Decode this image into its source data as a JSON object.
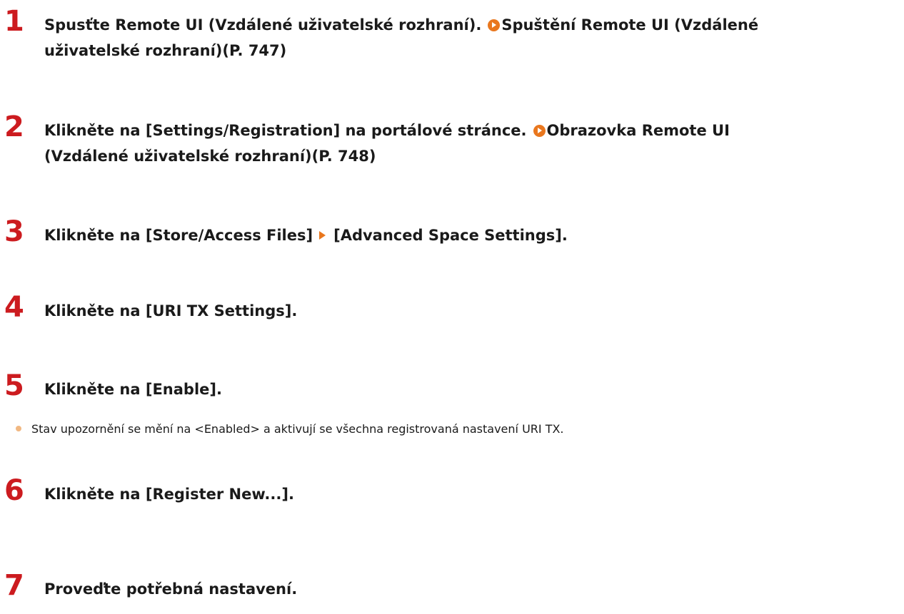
{
  "steps": [
    {
      "number": "1",
      "text": "Spusťte Remote UI (Vzdálené uživatelské rozhraní).",
      "link": "Spuštění Remote UI (Vzdálené",
      "link_cont": "uživatelské rozhraní)(P. 747)"
    },
    {
      "number": "2",
      "text": "Klikněte na [Settings/Registration] na portálové stránce.",
      "link": "Obrazovka Remote UI",
      "link_cont": "(Vzdálené uživatelské rozhraní)(P. 748)"
    },
    {
      "number": "3",
      "text_before": "Klikněte na [Store/Access Files]",
      "text_after": "[Advanced Space Settings]."
    },
    {
      "number": "4",
      "text": "Klikněte na [URI TX Settings]."
    },
    {
      "number": "5",
      "text": "Klikněte na [Enable].",
      "bullet": "Stav upozornění se mění na <Enabled> a aktivují se všechna registrovaná nastavení URI TX."
    },
    {
      "number": "6",
      "text": "Klikněte na [Register New...]."
    },
    {
      "number": "7",
      "text": "Proveďte potřebná nastavení."
    }
  ],
  "colors": {
    "step_number": "#cc1b1f",
    "link_icon": "#e9771e",
    "bullet": "#f1b882",
    "text": "#1a1a1a"
  },
  "icons": {
    "link": "link-arrow-icon",
    "menu_separator": "menu-arrow-icon",
    "bullet": "bullet-dot-icon"
  }
}
